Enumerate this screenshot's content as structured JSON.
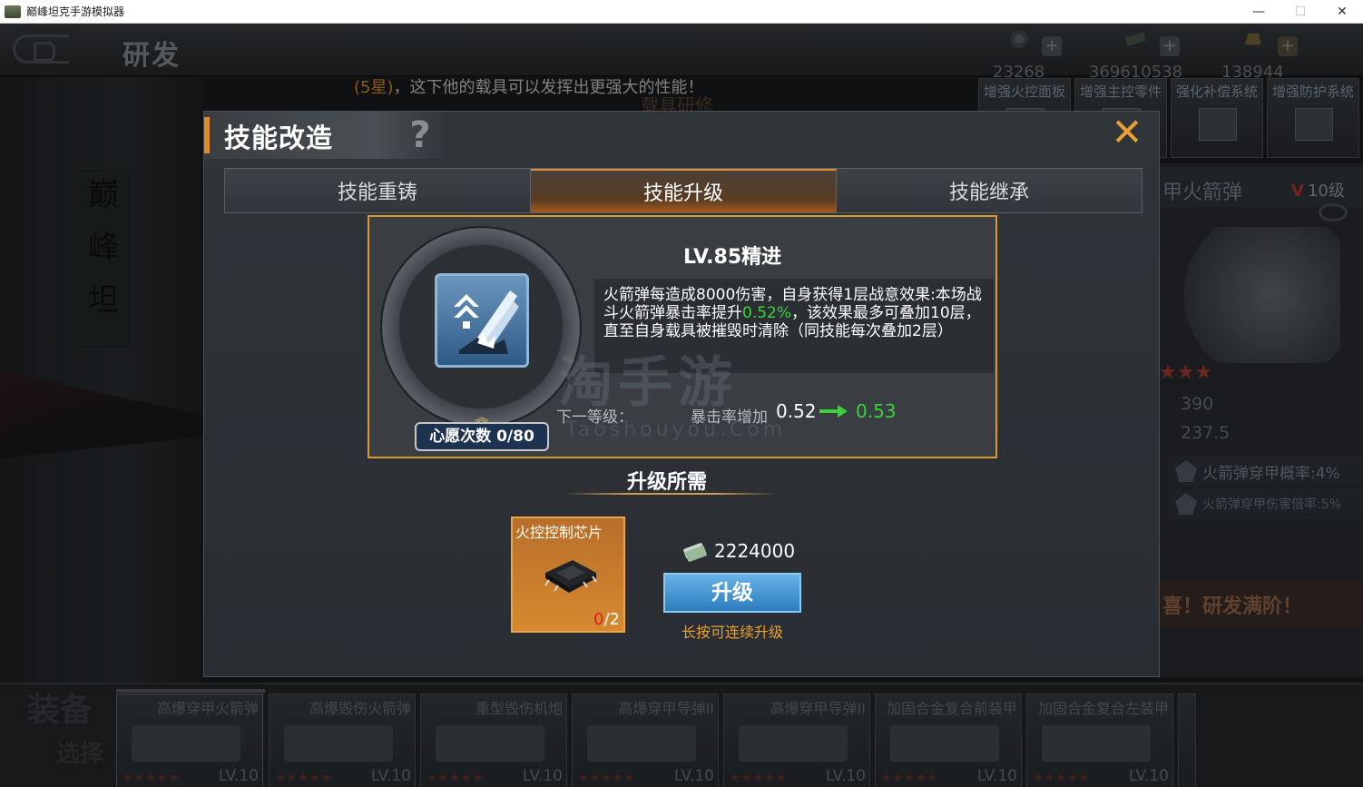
{
  "window": {
    "title": "巅峰坦克手游模拟器",
    "minimize": "—",
    "maximize": "☐",
    "close": "✕"
  },
  "header": {
    "title": "研发",
    "currencies": [
      {
        "name": "medal-icon",
        "value": "23268"
      },
      {
        "name": "cash-icon",
        "value": "369610538"
      },
      {
        "name": "gold-icon",
        "value": "138944"
      }
    ],
    "plus": "+"
  },
  "background": {
    "notice_star": "(5星)",
    "notice_text": "，这下他的载具可以发挥出更强大的性能！",
    "sub_text": "载具研修",
    "calligraphy": [
      "巅",
      "峰",
      "坦"
    ],
    "parts": [
      "增强火控面板",
      "增强主控零件",
      "强化补偿系统",
      "增强防护系统"
    ],
    "right_panel": {
      "name": "甲火箭弹",
      "level_v": "V",
      "level": "10级",
      "stars": "★★★",
      "stat1": "390",
      "stat2": "237.5",
      "skill1": "火箭弹穿甲概率:4%",
      "skill2": "火箭弹穿甲伤害倍率:5%",
      "congrats": "喜！研发满阶！"
    }
  },
  "equipment": {
    "label": "装备",
    "label2": "选择",
    "items": [
      {
        "name": "高爆穿甲火箭弹",
        "level": "LV.10",
        "stars": "★★★★★"
      },
      {
        "name": "高爆毁伤火箭弹",
        "level": "LV.10",
        "stars": "★★★★★"
      },
      {
        "name": "重型毁伤机炮",
        "level": "LV.10",
        "stars": "★★★★★"
      },
      {
        "name": "高爆穿甲导弹II",
        "level": "LV.10",
        "stars": "★★★★★"
      },
      {
        "name": "高爆穿甲导弹II",
        "level": "LV.10",
        "stars": "★★★★★"
      },
      {
        "name": "加固合金复合前装甲",
        "level": "LV.10",
        "stars": "★★★★★"
      },
      {
        "name": "加固合金复合左装甲",
        "level": "LV.10",
        "stars": "★★★★★"
      }
    ]
  },
  "modal": {
    "title": "技能改造",
    "help": "?",
    "close": "✕",
    "tabs": [
      "技能重铸",
      "技能升级",
      "技能继承"
    ],
    "active_tab": 1,
    "skill": {
      "level_title": "LV.85精进",
      "desc_part1": "火箭弹每造成8000伤害，自身获得1层战意效果:本场战斗火箭弹暴击率提升",
      "desc_highlight": "0.52%",
      "desc_part2": "，该效果最多可叠加10层，直至自身载具被摧毁时清除（同技能每次叠加2层）",
      "wish": "心愿次数 0/80",
      "next_label": "下一等级：",
      "crit_label": "暴击率增加",
      "crit_from": "0.52",
      "crit_to": "0.53"
    },
    "watermark": "淘手游",
    "watermark2": "Taoshouyou.Com",
    "requirements": {
      "title": "升级所需",
      "item_name": "火控控制芯片",
      "have": "0",
      "need": "/2",
      "cost": "2224000",
      "upgrade_label": "升级",
      "hold_tip": "长按可连续升级"
    }
  }
}
